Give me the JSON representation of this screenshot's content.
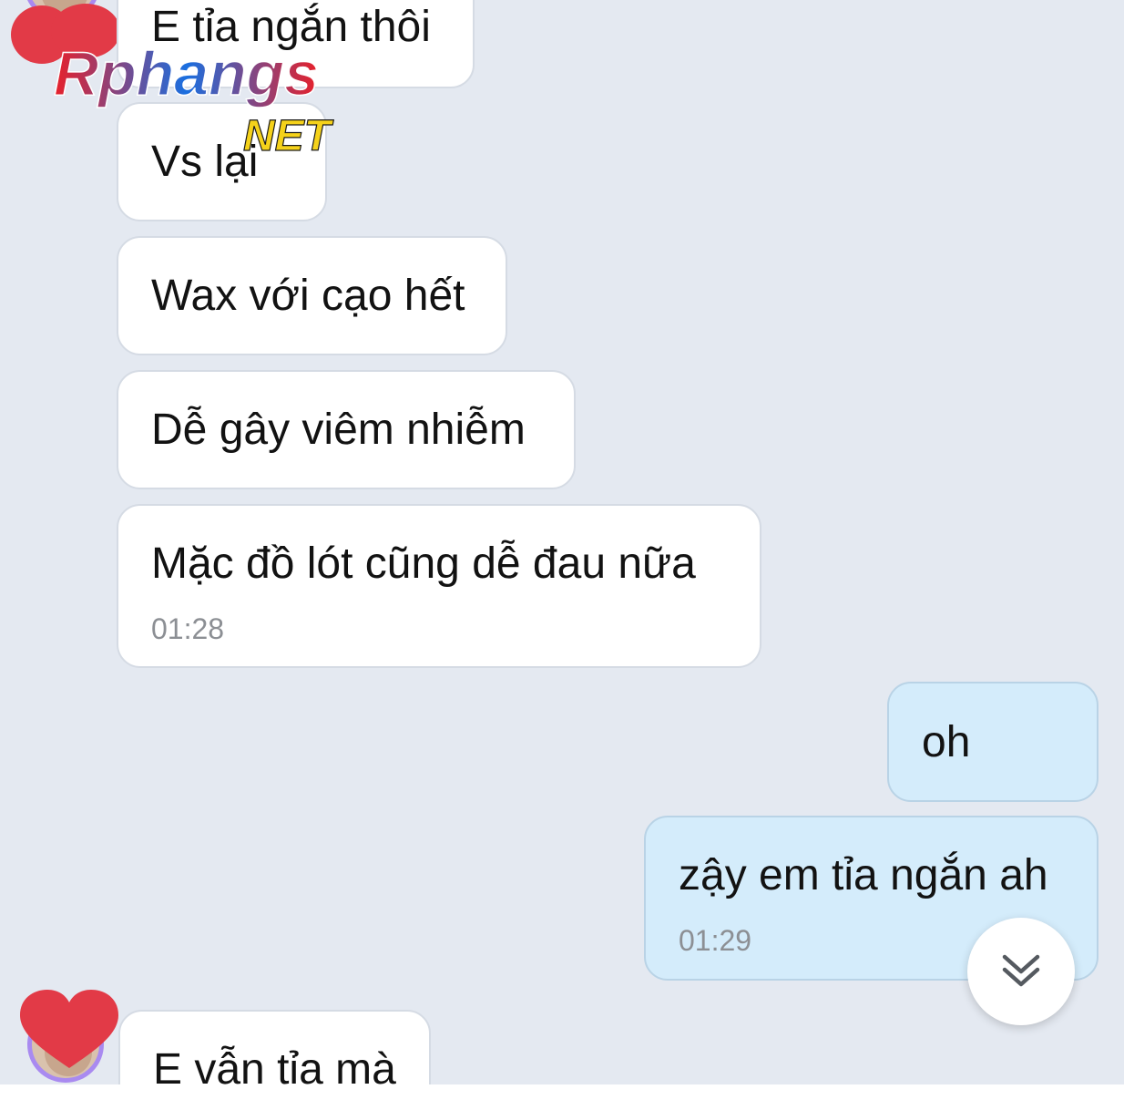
{
  "conversation": {
    "messages": [
      {
        "sender": "other",
        "text": "E tỉa ngắn thôi"
      },
      {
        "sender": "other",
        "text": "Vs lại"
      },
      {
        "sender": "other",
        "text": "Wax với cạo hết"
      },
      {
        "sender": "other",
        "text": "Dễ gây viêm nhiễm"
      },
      {
        "sender": "other",
        "text": "Mặc đồ lót cũng dễ đau nữa",
        "time": "01:28"
      },
      {
        "sender": "me",
        "text": "oh"
      },
      {
        "sender": "me",
        "text": "zậy em tỉa ngắn ah",
        "time": "01:29"
      },
      {
        "sender": "other",
        "text": "E vẫn tỉa mà"
      }
    ]
  },
  "watermark": {
    "brand": "Rphangs",
    "suffix": "NET"
  },
  "controls": {
    "scroll_down_icon": "double-chevron-down-icon"
  },
  "colors": {
    "chat_background": "#e4e9f1",
    "incoming_bubble": "#ffffff",
    "outgoing_bubble": "#d4ecfb",
    "timestamp": "#8c8f94",
    "avatar_ring": "#a98af0",
    "privacy_heart": "#e23a47"
  }
}
